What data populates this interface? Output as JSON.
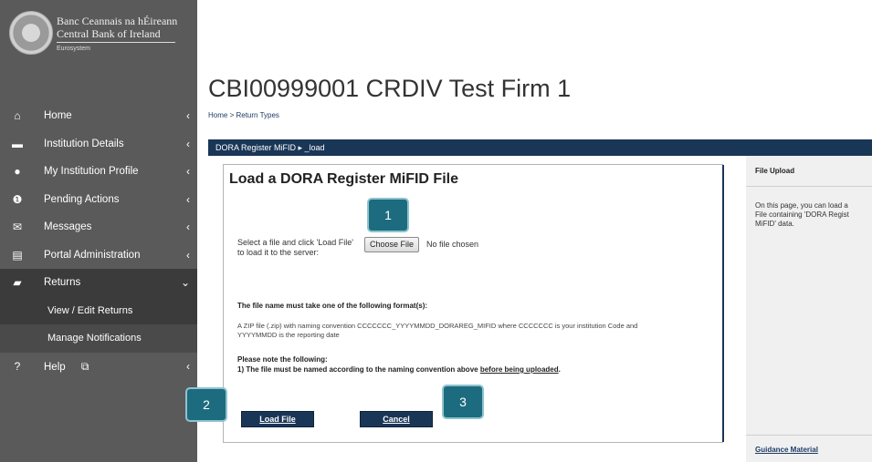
{
  "sidebar": {
    "brand": {
      "line1": "Banc Ceannais na hÉireann",
      "line2": "Central Bank of Ireland",
      "line3": "Eurosystem"
    },
    "items": [
      {
        "label": "Home",
        "icon": "home-icon"
      },
      {
        "label": "Institution Details",
        "icon": "briefcase-icon"
      },
      {
        "label": "My Institution Profile",
        "icon": "user-icon"
      },
      {
        "label": "Pending Actions",
        "icon": "alert-icon"
      },
      {
        "label": "Messages",
        "icon": "envelope-icon"
      },
      {
        "label": "Portal Administration",
        "icon": "list-icon"
      },
      {
        "label": "Returns",
        "icon": "folder-open-icon"
      },
      {
        "label": "Help",
        "icon": "question-icon"
      }
    ],
    "sub_items": [
      {
        "label": "View / Edit Returns"
      },
      {
        "label": "Manage Notifications"
      }
    ]
  },
  "header": {
    "title": "CBI00999001 CRDIV Test Firm 1",
    "breadcrumb": [
      "Home",
      "Return Types"
    ]
  },
  "blue_bar": {
    "text": "DORA Register MiFID ▸ _load"
  },
  "form": {
    "title": "Load a DORA Register MiFID File",
    "select_label": "Select a file and click 'Load File' to load it to the server:",
    "choose_button": "Choose File",
    "no_file_text": "No file chosen",
    "format_heading": "The file name must take one of the following format(s):",
    "format_text": "A ZIP file (.zip) with naming convention CCCCCCC_YYYYMMDD_DORAREG_MIFID where CCCCCCC is your institution Code and YYYYMMDD is the reporting date",
    "note_heading": "Please note the following:",
    "note_text_prefix": "1) The file must be named according to the naming convention above ",
    "note_text_link": "before being uploaded",
    "note_text_suffix": ".",
    "load_button": "Load File",
    "cancel_button": "Cancel"
  },
  "help_panel": {
    "title": "File Upload",
    "body": "On this page, you can load a\nFile containing 'DORA Regist\nMiFID' data.",
    "guidance_link": "Guidance Material"
  },
  "callouts": [
    {
      "number": "1"
    },
    {
      "number": "2"
    },
    {
      "number": "3"
    }
  ],
  "colors": {
    "sidebar_bg": "#5a5a5a",
    "sidebar_active": "#3b3b3b",
    "brand_navy": "#1a3657",
    "callout_teal": "#1d6b7e"
  }
}
